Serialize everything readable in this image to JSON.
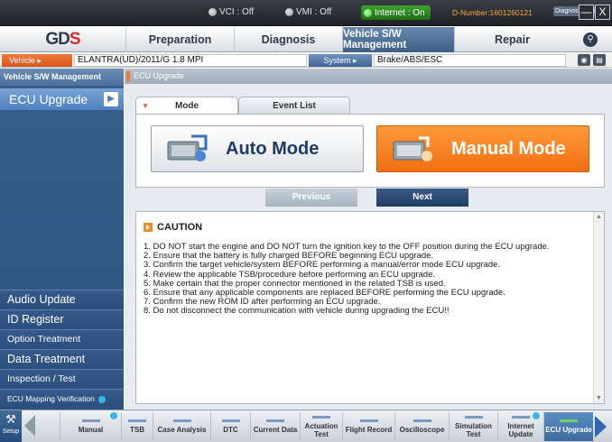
{
  "topbar": {
    "vci": "VCI : Off",
    "vmi": "VMI : Off",
    "internet": "Internet : On",
    "d_number": "D-Number:1601260121",
    "diag_finish": "Diagnosis Finish",
    "minimize": "—",
    "close": "X",
    "internet_color": "#2f9a23"
  },
  "menu": {
    "logo_left": "GD",
    "logo_right": "S",
    "items": [
      "Preparation",
      "Diagnosis",
      "Vehicle S/W Management",
      "Repair"
    ],
    "active_index": 2
  },
  "vehicle_bar": {
    "vehicle_label": "Vehicle",
    "vehicle_value": "ELANTRA(UD)/2011/G 1.8 MPI",
    "system_label": "System",
    "system_value": "Brake/ABS/ESC"
  },
  "sidebar": {
    "title": "Vehicle S/W Management",
    "active_item": "ECU Upgrade",
    "items": [
      "Audio Update",
      "ID Register",
      "Option Treatment",
      "Data Treatment",
      "Inspection / Test",
      "ECU Mapping Verification"
    ]
  },
  "content": {
    "breadcrumb": "ECU Upgrade",
    "tabs": [
      "Mode",
      "Event List"
    ],
    "auto_mode": "Auto Mode",
    "manual_mode": "Manual Mode",
    "previous": "Previous",
    "next": "Next",
    "caution_title": "CAUTION",
    "caution_items": [
      "1. DO NOT start the engine and DO NOT turn the ignition key to the OFF position during the ECU upgrade.",
      "2. Ensure that the battery is fully charged BEFORE beginning ECU upgrade.",
      "3. Confirm the target vehicle/system BEFORE performing a manual/error mode ECU upgrade.",
      "4. Review the applicable TSB/procedure before performing an ECU upgrade.",
      "5. Make certain that the proper connector mentioned in the related TSB is used.",
      "6. Ensure that any applicable components are replaced BEFORE performing the ECU upgrade.",
      "7. Confirm the new ROM ID after performing an ECU upgrade.",
      "8. Do not disconnect the communication with vehicle during upgrading the ECU!!"
    ]
  },
  "toolbar": {
    "setup": "Setup",
    "tools": [
      "Manual",
      "TSB",
      "Case Analysis",
      "DTC",
      "Current Data",
      "Actuation Test",
      "Flight Record",
      "Oscilloscope",
      "Simulation Test",
      "Internet Update",
      "ECU Upgrade"
    ]
  },
  "colors": {
    "accent_orange": "#f26f12",
    "nav_blue": "#1f3c65",
    "sidebar_blue": "#2e527f"
  }
}
